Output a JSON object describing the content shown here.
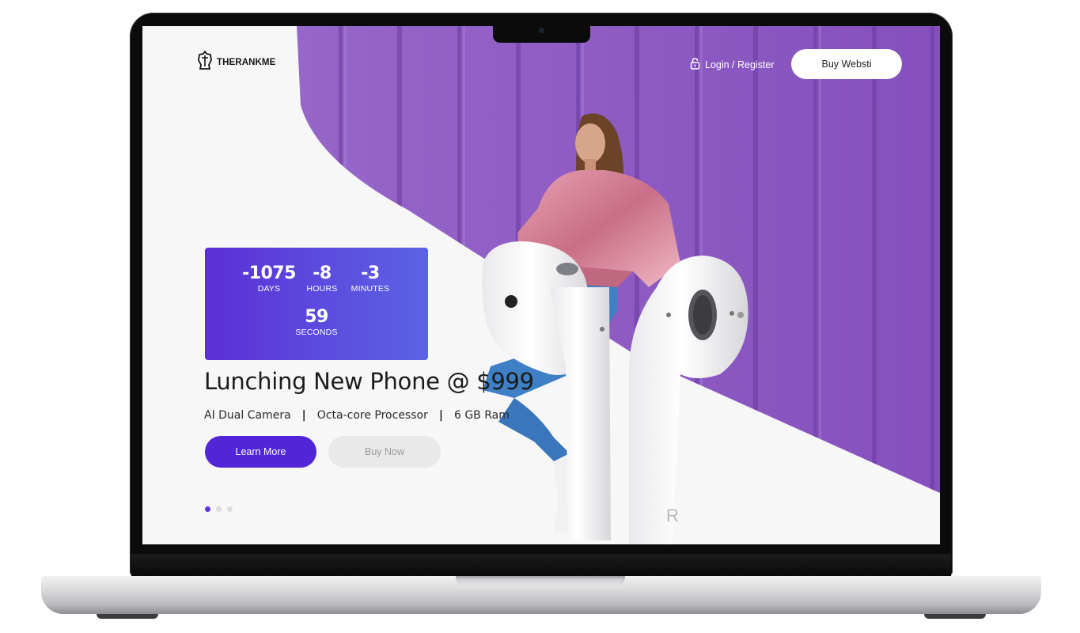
{
  "brand": {
    "name": "THERANKME"
  },
  "nav": {
    "login_label": "Login / Register",
    "buy_label": "Buy Websti"
  },
  "countdown": {
    "days": "-1075",
    "days_label": "DAYS",
    "hours": "-8",
    "hours_label": "HOURS",
    "minutes": "-3",
    "minutes_label": "MINUTES",
    "seconds": "59",
    "seconds_label": "SECONDS"
  },
  "hero": {
    "headline": "Lunching New Phone @ $999",
    "features": [
      "AI Dual Camera",
      "Octa-core Processor",
      "6 GB Ram"
    ],
    "separator": "|",
    "learn_more_label": "Learn More",
    "buy_now_label": "Buy Now",
    "slides": {
      "count": 3,
      "active": 1
    },
    "faded_letter": "R"
  },
  "colors": {
    "accent": "#5126d6",
    "hero_purple": "#8e5cc4",
    "countdown_start": "#5b2fd6",
    "countdown_end": "#5a63e2",
    "jacket_pink": "#d98a9e",
    "jeans_blue": "#3f7fc6"
  },
  "icons": {
    "brand": "knight-helmet-icon",
    "login": "lock-icon"
  }
}
